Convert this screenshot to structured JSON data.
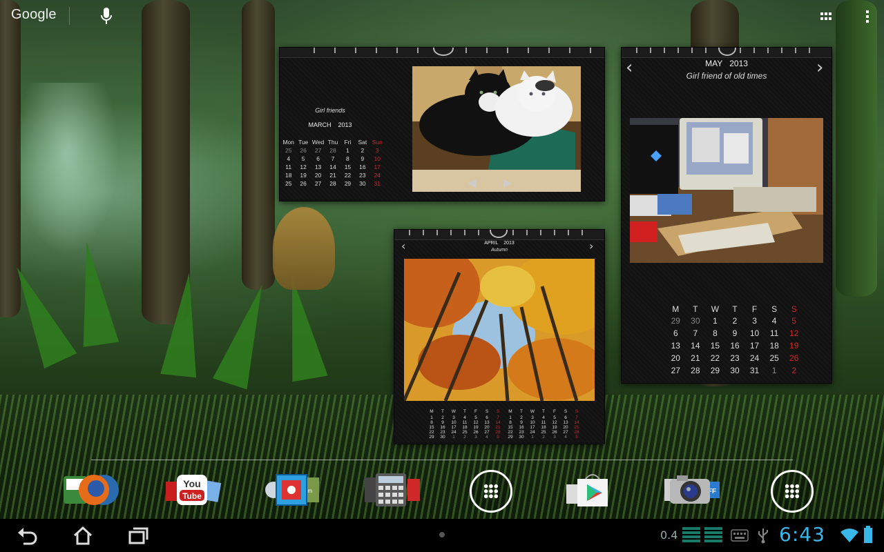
{
  "search_bar": {
    "logo": "Google",
    "voice_icon": "microphone-icon"
  },
  "top_right": {
    "apps_icon": "grid-icon",
    "overflow_icon": "overflow-menu-icon"
  },
  "calendar_march": {
    "title": "Girl friends",
    "month": "MARCH",
    "year": "2013",
    "weekdays": [
      "Mon",
      "Tue",
      "Wed",
      "Thu",
      "Fri",
      "Sat",
      "Sun"
    ],
    "rows": [
      [
        "25",
        "26",
        "27",
        "28",
        "1",
        "2",
        "3"
      ],
      [
        "4",
        "5",
        "6",
        "7",
        "8",
        "9",
        "10"
      ],
      [
        "11",
        "12",
        "13",
        "14",
        "15",
        "16",
        "17"
      ],
      [
        "18",
        "19",
        "20",
        "21",
        "22",
        "23",
        "24"
      ],
      [
        "25",
        "26",
        "27",
        "28",
        "29",
        "30",
        "31"
      ]
    ],
    "photo": "cats"
  },
  "calendar_april": {
    "month": "APRIL",
    "year": "2013",
    "title": "Autumn",
    "prev_icon": "chevron-left-icon",
    "next_icon": "chevron-right-icon",
    "weekdays": [
      "M",
      "T",
      "W",
      "T",
      "F",
      "S",
      "S"
    ],
    "left_rows": [
      [
        "1",
        "2",
        "3",
        "4",
        "5",
        "6",
        "7"
      ],
      [
        "8",
        "9",
        "10",
        "11",
        "12",
        "13",
        "14"
      ],
      [
        "15",
        "16",
        "17",
        "18",
        "19",
        "20",
        "21"
      ],
      [
        "22",
        "23",
        "24",
        "25",
        "26",
        "27",
        "28"
      ],
      [
        "29",
        "30",
        "1",
        "2",
        "3",
        "4",
        "5"
      ]
    ],
    "right_rows": [
      [
        "1",
        "2",
        "3",
        "4",
        "5",
        "6",
        "7"
      ],
      [
        "8",
        "9",
        "10",
        "11",
        "12",
        "13",
        "14"
      ],
      [
        "15",
        "16",
        "17",
        "18",
        "19",
        "20",
        "21"
      ],
      [
        "22",
        "23",
        "24",
        "25",
        "26",
        "27",
        "28"
      ],
      [
        "29",
        "30",
        "1",
        "2",
        "3",
        "4",
        "5"
      ]
    ]
  },
  "calendar_may": {
    "month": "MAY",
    "year": "2013",
    "title": "Girl friend of old times",
    "prev_icon": "chevron-left-icon",
    "next_icon": "chevron-right-icon",
    "weekdays": [
      "M",
      "T",
      "W",
      "T",
      "F",
      "S",
      "S"
    ],
    "rows": [
      [
        "29",
        "30",
        "1",
        "2",
        "3",
        "4",
        "5"
      ],
      [
        "6",
        "7",
        "8",
        "9",
        "10",
        "11",
        "12"
      ],
      [
        "13",
        "14",
        "15",
        "16",
        "17",
        "18",
        "19"
      ],
      [
        "20",
        "21",
        "22",
        "23",
        "24",
        "25",
        "26"
      ],
      [
        "27",
        "28",
        "29",
        "30",
        "31",
        "1",
        "2"
      ]
    ]
  },
  "dock": {
    "items": [
      "folder-firefox-icon",
      "folder-youtube-icon",
      "folder-tools-icon",
      "folder-office-icon",
      "app-drawer-icon",
      "folder-play-store-icon",
      "folder-camera-icon",
      "app-drawer-icon"
    ]
  },
  "system_bar": {
    "back_icon": "back-icon",
    "home_icon": "home-icon",
    "recents_icon": "recent-apps-icon",
    "status_value": "0.4",
    "clock": "6:43",
    "wifi_icon": "wifi-icon",
    "usb_icon": "usb-icon"
  }
}
